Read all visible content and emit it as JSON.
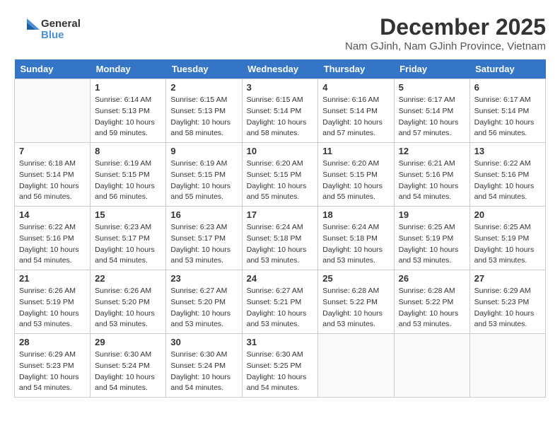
{
  "header": {
    "logo_general": "General",
    "logo_blue": "Blue",
    "month_year": "December 2025",
    "location": "Nam GJinh, Nam GJinh Province, Vietnam"
  },
  "weekdays": [
    "Sunday",
    "Monday",
    "Tuesday",
    "Wednesday",
    "Thursday",
    "Friday",
    "Saturday"
  ],
  "weeks": [
    [
      {
        "day": "",
        "sunrise": "",
        "sunset": "",
        "daylight": ""
      },
      {
        "day": "1",
        "sunrise": "Sunrise: 6:14 AM",
        "sunset": "Sunset: 5:13 PM",
        "daylight": "Daylight: 10 hours and 59 minutes."
      },
      {
        "day": "2",
        "sunrise": "Sunrise: 6:15 AM",
        "sunset": "Sunset: 5:13 PM",
        "daylight": "Daylight: 10 hours and 58 minutes."
      },
      {
        "day": "3",
        "sunrise": "Sunrise: 6:15 AM",
        "sunset": "Sunset: 5:14 PM",
        "daylight": "Daylight: 10 hours and 58 minutes."
      },
      {
        "day": "4",
        "sunrise": "Sunrise: 6:16 AM",
        "sunset": "Sunset: 5:14 PM",
        "daylight": "Daylight: 10 hours and 57 minutes."
      },
      {
        "day": "5",
        "sunrise": "Sunrise: 6:17 AM",
        "sunset": "Sunset: 5:14 PM",
        "daylight": "Daylight: 10 hours and 57 minutes."
      },
      {
        "day": "6",
        "sunrise": "Sunrise: 6:17 AM",
        "sunset": "Sunset: 5:14 PM",
        "daylight": "Daylight: 10 hours and 56 minutes."
      }
    ],
    [
      {
        "day": "7",
        "sunrise": "Sunrise: 6:18 AM",
        "sunset": "Sunset: 5:14 PM",
        "daylight": "Daylight: 10 hours and 56 minutes."
      },
      {
        "day": "8",
        "sunrise": "Sunrise: 6:19 AM",
        "sunset": "Sunset: 5:15 PM",
        "daylight": "Daylight: 10 hours and 56 minutes."
      },
      {
        "day": "9",
        "sunrise": "Sunrise: 6:19 AM",
        "sunset": "Sunset: 5:15 PM",
        "daylight": "Daylight: 10 hours and 55 minutes."
      },
      {
        "day": "10",
        "sunrise": "Sunrise: 6:20 AM",
        "sunset": "Sunset: 5:15 PM",
        "daylight": "Daylight: 10 hours and 55 minutes."
      },
      {
        "day": "11",
        "sunrise": "Sunrise: 6:20 AM",
        "sunset": "Sunset: 5:15 PM",
        "daylight": "Daylight: 10 hours and 55 minutes."
      },
      {
        "day": "12",
        "sunrise": "Sunrise: 6:21 AM",
        "sunset": "Sunset: 5:16 PM",
        "daylight": "Daylight: 10 hours and 54 minutes."
      },
      {
        "day": "13",
        "sunrise": "Sunrise: 6:22 AM",
        "sunset": "Sunset: 5:16 PM",
        "daylight": "Daylight: 10 hours and 54 minutes."
      }
    ],
    [
      {
        "day": "14",
        "sunrise": "Sunrise: 6:22 AM",
        "sunset": "Sunset: 5:16 PM",
        "daylight": "Daylight: 10 hours and 54 minutes."
      },
      {
        "day": "15",
        "sunrise": "Sunrise: 6:23 AM",
        "sunset": "Sunset: 5:17 PM",
        "daylight": "Daylight: 10 hours and 54 minutes."
      },
      {
        "day": "16",
        "sunrise": "Sunrise: 6:23 AM",
        "sunset": "Sunset: 5:17 PM",
        "daylight": "Daylight: 10 hours and 53 minutes."
      },
      {
        "day": "17",
        "sunrise": "Sunrise: 6:24 AM",
        "sunset": "Sunset: 5:18 PM",
        "daylight": "Daylight: 10 hours and 53 minutes."
      },
      {
        "day": "18",
        "sunrise": "Sunrise: 6:24 AM",
        "sunset": "Sunset: 5:18 PM",
        "daylight": "Daylight: 10 hours and 53 minutes."
      },
      {
        "day": "19",
        "sunrise": "Sunrise: 6:25 AM",
        "sunset": "Sunset: 5:19 PM",
        "daylight": "Daylight: 10 hours and 53 minutes."
      },
      {
        "day": "20",
        "sunrise": "Sunrise: 6:25 AM",
        "sunset": "Sunset: 5:19 PM",
        "daylight": "Daylight: 10 hours and 53 minutes."
      }
    ],
    [
      {
        "day": "21",
        "sunrise": "Sunrise: 6:26 AM",
        "sunset": "Sunset: 5:19 PM",
        "daylight": "Daylight: 10 hours and 53 minutes."
      },
      {
        "day": "22",
        "sunrise": "Sunrise: 6:26 AM",
        "sunset": "Sunset: 5:20 PM",
        "daylight": "Daylight: 10 hours and 53 minutes."
      },
      {
        "day": "23",
        "sunrise": "Sunrise: 6:27 AM",
        "sunset": "Sunset: 5:20 PM",
        "daylight": "Daylight: 10 hours and 53 minutes."
      },
      {
        "day": "24",
        "sunrise": "Sunrise: 6:27 AM",
        "sunset": "Sunset: 5:21 PM",
        "daylight": "Daylight: 10 hours and 53 minutes."
      },
      {
        "day": "25",
        "sunrise": "Sunrise: 6:28 AM",
        "sunset": "Sunset: 5:22 PM",
        "daylight": "Daylight: 10 hours and 53 minutes."
      },
      {
        "day": "26",
        "sunrise": "Sunrise: 6:28 AM",
        "sunset": "Sunset: 5:22 PM",
        "daylight": "Daylight: 10 hours and 53 minutes."
      },
      {
        "day": "27",
        "sunrise": "Sunrise: 6:29 AM",
        "sunset": "Sunset: 5:23 PM",
        "daylight": "Daylight: 10 hours and 53 minutes."
      }
    ],
    [
      {
        "day": "28",
        "sunrise": "Sunrise: 6:29 AM",
        "sunset": "Sunset: 5:23 PM",
        "daylight": "Daylight: 10 hours and 54 minutes."
      },
      {
        "day": "29",
        "sunrise": "Sunrise: 6:30 AM",
        "sunset": "Sunset: 5:24 PM",
        "daylight": "Daylight: 10 hours and 54 minutes."
      },
      {
        "day": "30",
        "sunrise": "Sunrise: 6:30 AM",
        "sunset": "Sunset: 5:24 PM",
        "daylight": "Daylight: 10 hours and 54 minutes."
      },
      {
        "day": "31",
        "sunrise": "Sunrise: 6:30 AM",
        "sunset": "Sunset: 5:25 PM",
        "daylight": "Daylight: 10 hours and 54 minutes."
      },
      {
        "day": "",
        "sunrise": "",
        "sunset": "",
        "daylight": ""
      },
      {
        "day": "",
        "sunrise": "",
        "sunset": "",
        "daylight": ""
      },
      {
        "day": "",
        "sunrise": "",
        "sunset": "",
        "daylight": ""
      }
    ]
  ]
}
